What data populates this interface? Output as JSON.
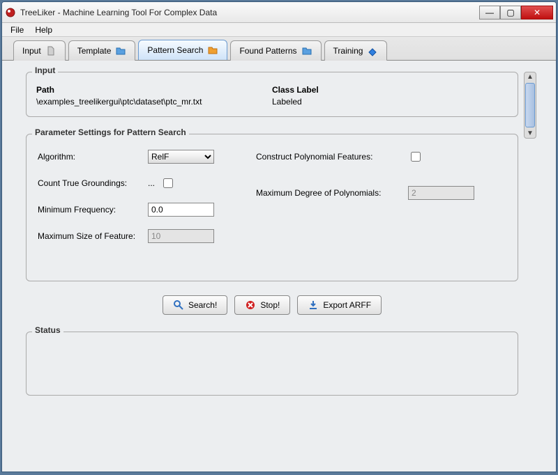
{
  "window": {
    "title": "TreeLiker - Machine Learning Tool For Complex Data"
  },
  "menubar": {
    "file": "File",
    "help": "Help"
  },
  "tabs": {
    "input": "Input",
    "template": "Template",
    "pattern_search": "Pattern Search",
    "found_patterns": "Found Patterns",
    "training": "Training"
  },
  "input_panel": {
    "title": "Input",
    "path_label": "Path",
    "path_value": "\\examples_treelikergui\\ptc\\dataset\\ptc_mr.txt",
    "class_label_label": "Class Label",
    "class_label_value": "Labeled"
  },
  "settings_panel": {
    "title": "Parameter Settings for Pattern Search",
    "algorithm_label": "Algorithm:",
    "algorithm_value": "RelF",
    "count_true_groundings_label": "Count True Groundings:",
    "count_true_groundings_ellipsis": "...",
    "count_true_groundings_checked": false,
    "minimum_frequency_label": "Minimum Frequency:",
    "minimum_frequency_value": "0.0",
    "maximum_size_label": "Maximum Size of Feature:",
    "maximum_size_value": "10",
    "construct_poly_label": "Construct Polynomial Features:",
    "construct_poly_checked": false,
    "max_degree_label": "Maximum Degree of Polynomials:",
    "max_degree_value": "2"
  },
  "buttons": {
    "search": "Search!",
    "stop": "Stop!",
    "export": "Export ARFF"
  },
  "status_panel": {
    "title": "Status"
  }
}
